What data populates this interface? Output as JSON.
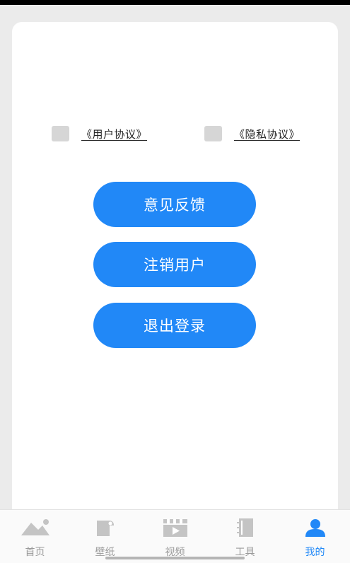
{
  "agreements": {
    "user_label": "《用户协议》",
    "privacy_label": "《隐私协议》"
  },
  "buttons": {
    "feedback": "意见反馈",
    "delete_account": "注销用户",
    "logout": "退出登录"
  },
  "tabbar": {
    "home": {
      "label": "首页",
      "icon": "mountain-icon"
    },
    "wallpaper": {
      "label": "壁纸",
      "icon": "wallpaper-icon"
    },
    "video": {
      "label": "视频",
      "icon": "video-clapper-icon"
    },
    "tools": {
      "label": "工具",
      "icon": "notebook-icon"
    },
    "mine": {
      "label": "我的",
      "icon": "user-icon"
    },
    "active": "mine"
  },
  "colors": {
    "accent": "#2188f7",
    "inactive": "#c4c4c4",
    "checkbox": "#d6d6d6"
  }
}
